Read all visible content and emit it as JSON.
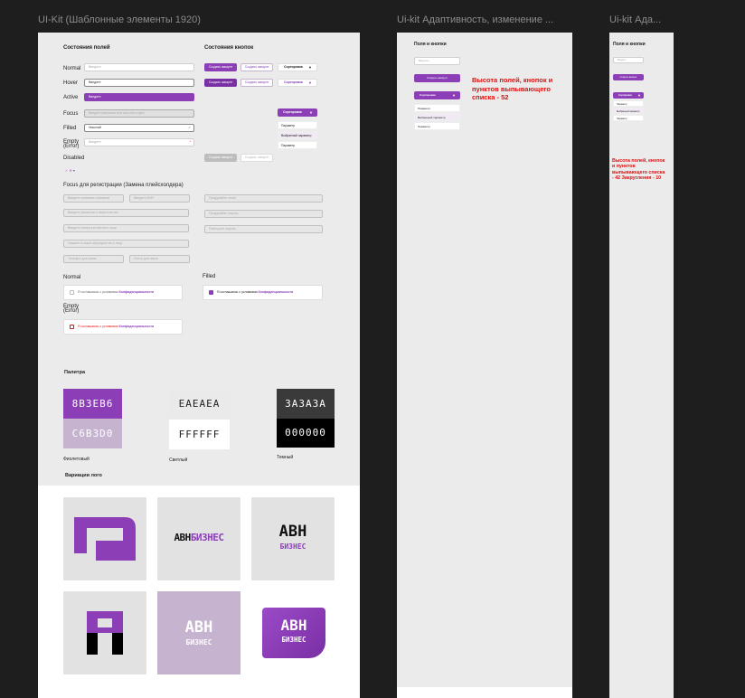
{
  "frames": {
    "f1": "UI-Kit (Шаблонные элементы 1920)",
    "f2": "Ui-kit Адаптивность, изменение ...",
    "f3": "Ui-kit Ада..."
  },
  "colors": {
    "accent": "#8B3EB6",
    "accent_light": "#C6B3D0",
    "light_gray": "#EAEAEA",
    "dark_gray": "#3A3A3A",
    "white": "#FFFFFF",
    "black": "#000000",
    "note_red": "#E01010"
  },
  "kit": {
    "field_states_title": "Состояния полей",
    "button_states_title": "Состояния кнопок",
    "states": [
      "Normal",
      "Hover",
      "Active",
      "Focus",
      "Filled",
      "Empty\n(Error)",
      "Disabled"
    ],
    "field_texts": [
      "Введите",
      "Введите",
      "Введите",
      "Введите фамилию или имя или отдел",
      "Николай",
      "Введите"
    ],
    "btn_create_fill": "Создать аккаунт",
    "btn_create_outline": "Создать аккаунт",
    "sort_label": "Сортировка",
    "dropdown": [
      "Параметр",
      "Выбранный параметр",
      "Параметр"
    ],
    "disabled_mark": "✓ ✕ ▾",
    "focus_title": "Focus для регистрации (Замена плейсхолдера)",
    "reg_fields": [
      "Введите название компании",
      "Введите ИНН",
      "Введите фамилию и имя/отчество",
      "Введите номер контактного лица",
      "Укажите в какое мероприятие в лицо",
      "Телефон для связи",
      "Почта для связи",
      "Придумайте логин",
      "Придумайте пароль",
      "Повторите пароль"
    ],
    "normal_label": "Normal",
    "filled_label": "Filled",
    "empty_label": "Empty\n(Error)",
    "consent_prefix": "Я соглашаюсь с условиями",
    "consent_link": "Конфиденциальности",
    "palette_title": "Палитра",
    "swatches": [
      "8B3EB6",
      "C6B3D0",
      "EAEAEA",
      "FFFFFF",
      "3A3A3A",
      "000000"
    ],
    "palette_names": [
      "Фиолетовый",
      "Светлый",
      "Темный"
    ],
    "logo_title": "Вариации лого",
    "logo_text_1": "АВН",
    "logo_text_2": "БИЗНЕС"
  },
  "adaptive": {
    "section_title": "Поля и кнопки",
    "field_placeholder": "Введите",
    "btn_create": "Создать аккаунт",
    "sort_label": "Сортировка",
    "dropdown": [
      "Параметр",
      "Выбранный параметр",
      "Параметр"
    ],
    "note_52": "Высота полей, кнопок и пунктов выпывающего списка - 52",
    "note_42": "Высота полей, кнопок и пунктов выпывающего списка - 42 Закругления - 10"
  }
}
